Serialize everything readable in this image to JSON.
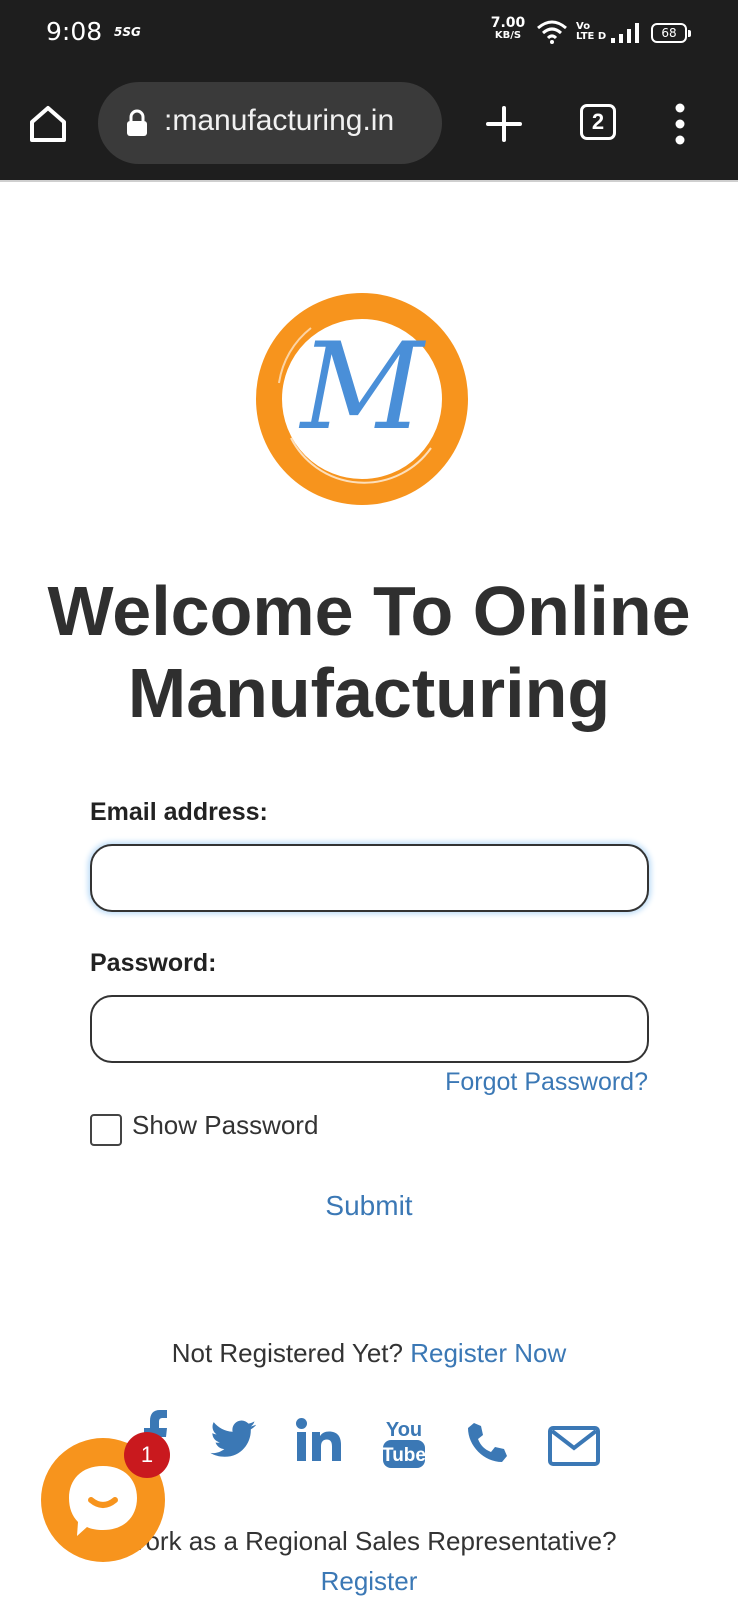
{
  "status_bar": {
    "time": "9:08",
    "carrier_icon": "5SG",
    "net_speed_value": "7.00",
    "net_speed_unit": "KB/S",
    "volte_top": "Vo",
    "volte_bottom": "LTE D",
    "battery": "68",
    "icons": [
      "wifi-icon",
      "signal-icon",
      "battery-icon"
    ]
  },
  "browser": {
    "url": ":manufacturing.in",
    "tab_count": "2",
    "icons": [
      "home-icon",
      "lock-icon",
      "plus-icon",
      "tabs-icon",
      "more-vertical-icon"
    ]
  },
  "page": {
    "title": "Welcome To Online Manufacturing",
    "logo_letter": "M",
    "form": {
      "email_label": "Email address:",
      "email_value": "",
      "password_label": "Password:",
      "password_value": "",
      "forgot_password": "Forgot Password?",
      "show_password_label": "Show Password",
      "show_password_checked": false,
      "submit_label": "Submit"
    },
    "register": {
      "prompt": "Not Registered Yet?",
      "link": "Register Now"
    },
    "social_icons": [
      "facebook-icon",
      "twitter-icon",
      "linkedin-icon",
      "youtube-icon",
      "phone-icon",
      "mail-icon"
    ],
    "rep": {
      "prompt": "Work as a Regional Sales Representative?",
      "link": "Register"
    }
  },
  "chat_widget": {
    "badge_count": "1"
  },
  "colors": {
    "chrome_bg": "#1e1e1e",
    "link_blue": "#3b78b5",
    "logo_orange": "#f7941d",
    "logo_blue": "#4a8fd8",
    "badge_red": "#c9191e"
  }
}
